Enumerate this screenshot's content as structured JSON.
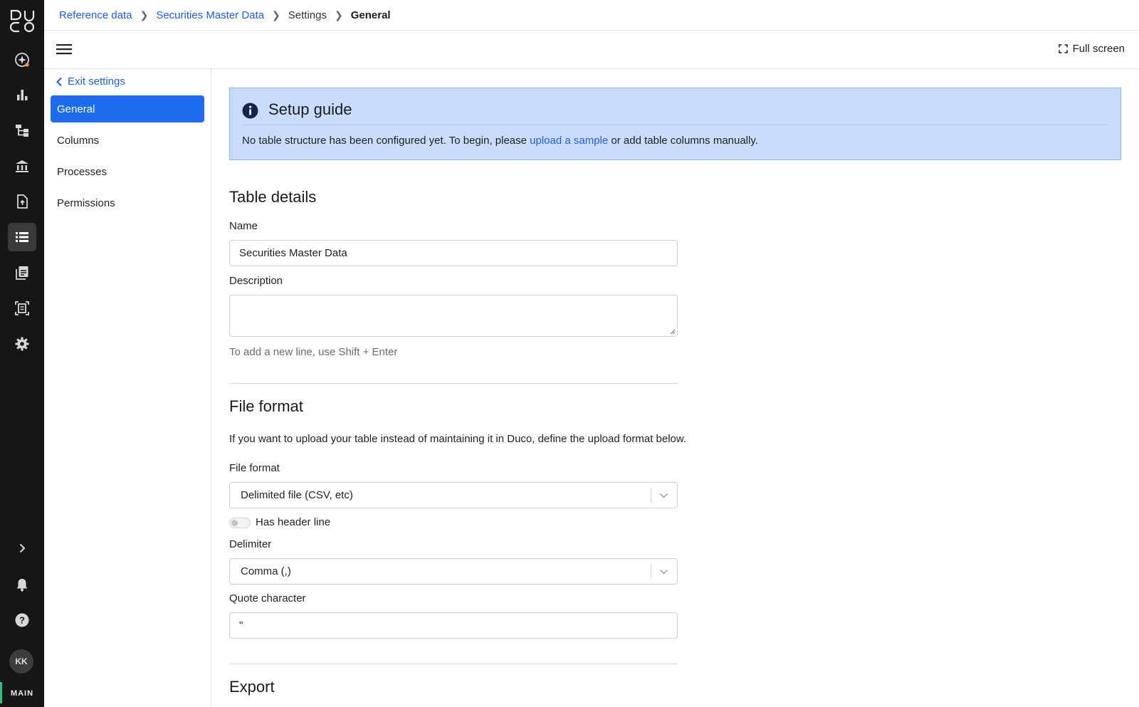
{
  "app": {
    "logo_alt": "Duco",
    "env_label": "MAIN",
    "user_initials": "KK"
  },
  "rail": {
    "icons": [
      "sparkle-icon",
      "bar-chart-icon",
      "hierarchy-icon",
      "bank-icon",
      "file-upload-icon",
      "table-list-icon",
      "report-icon",
      "scan-document-icon",
      "gear-icon",
      "expand-chevron-icon",
      "bell-icon",
      "help-icon"
    ],
    "active": "table-list-icon",
    "accent_color": "#2ec27e"
  },
  "breadcrumb": {
    "items": [
      "Reference data",
      "Securities Master Data",
      "Settings",
      "General"
    ]
  },
  "toolbar": {
    "fullscreen_label": "Full screen"
  },
  "settings_nav": {
    "exit_label": "Exit settings",
    "items": [
      "General",
      "Columns",
      "Processes",
      "Permissions"
    ],
    "active_color": "#1d6cf0"
  },
  "setup_guide": {
    "title": "Setup guide",
    "text_before": "No table structure has been configured yet. To begin, please ",
    "link": "upload a sample",
    "text_after": " or add table columns manually."
  },
  "table_details": {
    "heading": "Table details",
    "name_label": "Name",
    "name_value": "Securities Master Data",
    "description_label": "Description",
    "description_value": "",
    "description_hint": "To add a new line, use Shift + Enter"
  },
  "file_format": {
    "heading": "File format",
    "description": "If you want to upload your table instead of maintaining it in Duco, define the upload format below.",
    "format_label": "File format",
    "format_value": "Delimited file (CSV, etc)",
    "header_toggle_label": "Has header line",
    "header_toggle_on": false,
    "delimiter_label": "Delimiter",
    "delimiter_value": "Comma (,)",
    "quote_label": "Quote character",
    "quote_value": "\""
  },
  "export": {
    "heading": "Export"
  }
}
